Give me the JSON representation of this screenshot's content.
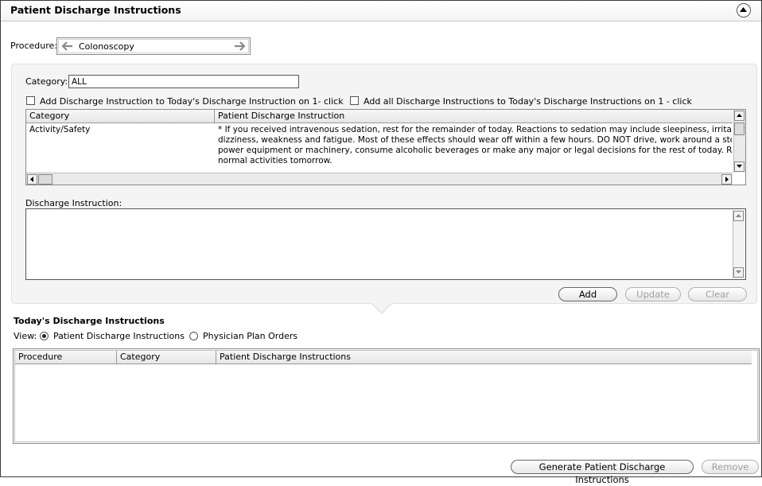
{
  "header": {
    "title": "Patient Discharge Instructions"
  },
  "procedure": {
    "label": "Procedure:",
    "value": "Colonoscopy"
  },
  "category": {
    "label": "Category:",
    "value": "ALL"
  },
  "checkboxes": {
    "add_one": "Add Discharge Instruction to Today's Discharge Instruction on 1- click",
    "add_all": "Add all Discharge Instructions to Today's Discharge Instructions on 1 - click"
  },
  "instructions_grid": {
    "columns": [
      "Category",
      "Patient Discharge Instruction"
    ],
    "rows": [
      {
        "category": "Activity/Safety",
        "instruction_lines": [
          "* If you received intravenous sedation, rest for the remainder of today.  Reactions to sedation may include sleepiness, irritabili",
          "dizziness, weakness and fatigue.  Most of these effects should wear off within a few hours.  DO NOT drive, work around a sto",
          "power equipment or machinery, consume alcoholic beverages or make any major or legal decisions for the rest of today.  Resu",
          "normal activities tomorrow."
        ]
      }
    ]
  },
  "discharge_instruction": {
    "label": "Discharge Instruction:",
    "value": ""
  },
  "buttons": {
    "add": "Add",
    "update": "Update",
    "clear": "Clear",
    "generate": "Generate Patient Discharge Instructions",
    "remove": "Remove"
  },
  "today": {
    "title": "Today's Discharge Instructions",
    "view_label": "View:",
    "options": [
      "Patient Discharge Instructions",
      "Physician Plan Orders"
    ],
    "selected": "Patient Discharge Instructions",
    "columns": [
      "Procedure",
      "Category",
      "Patient Discharge Instructions"
    ]
  }
}
